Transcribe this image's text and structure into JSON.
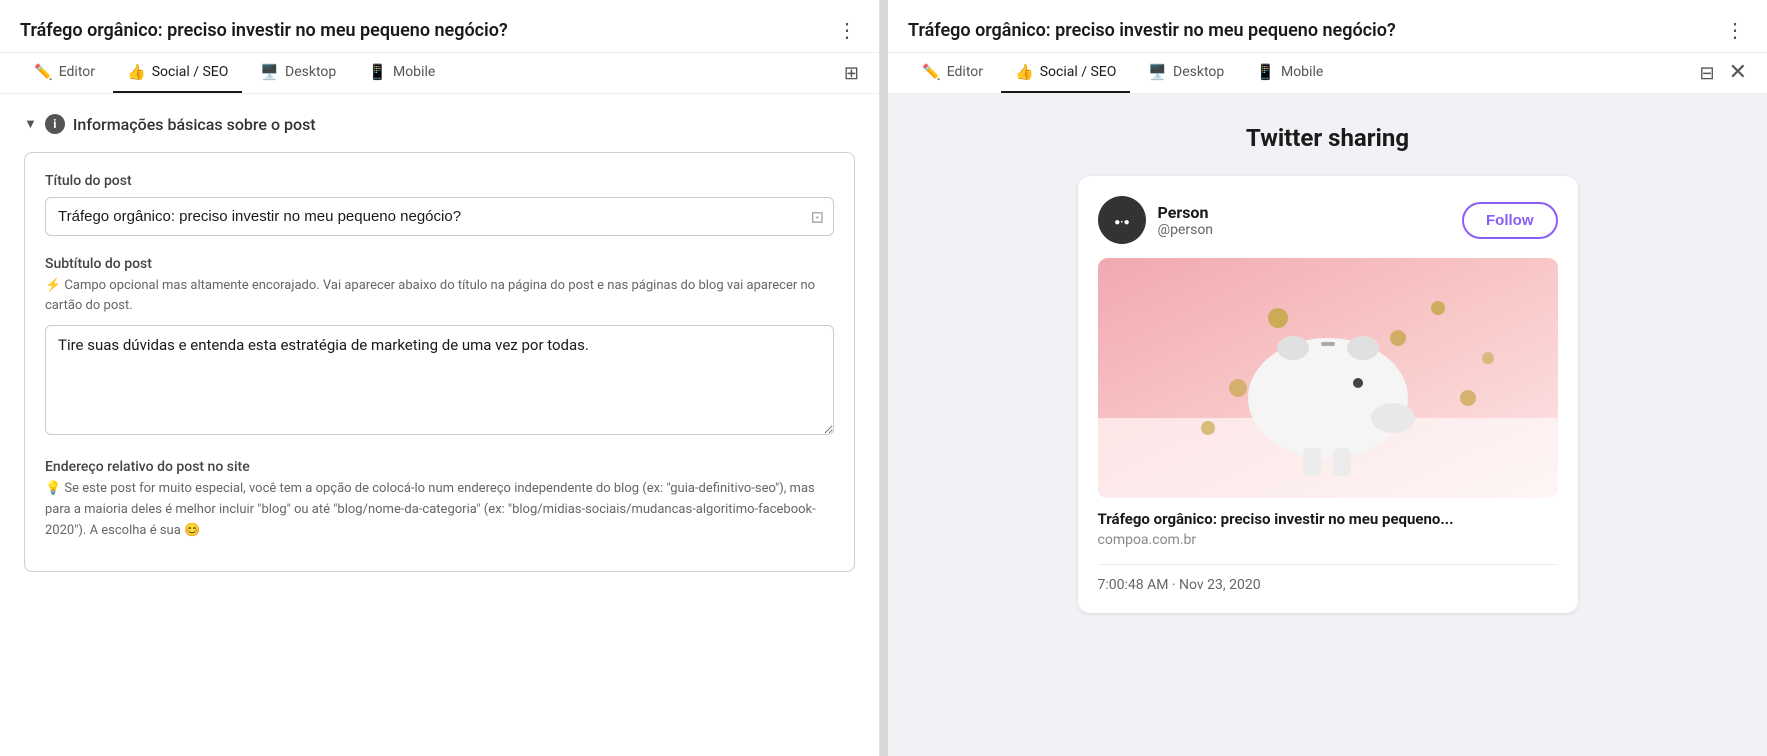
{
  "left": {
    "title": "Tráfego orgânico: preciso investir no meu pequeno negócio?",
    "more_icon": "⋮",
    "tabs": [
      {
        "id": "editor",
        "label": "Editor",
        "icon": "✏️",
        "active": false
      },
      {
        "id": "social-seo",
        "label": "Social / SEO",
        "icon": "👍",
        "active": true
      },
      {
        "id": "desktop",
        "label": "Desktop",
        "icon": "🖥️",
        "active": false
      },
      {
        "id": "mobile",
        "label": "Mobile",
        "icon": "📱",
        "active": false
      }
    ],
    "split_icon": "⊞",
    "section": {
      "toggle": "▼",
      "info_icon": "i",
      "title": "Informações básicas sobre o post"
    },
    "form": {
      "titulo_label": "Título do post",
      "titulo_value": "Tráfego orgânico: preciso investir no meu pequeno negócio?",
      "titulo_icon": "⊡",
      "subtitulo_label": "Subtítulo do post",
      "subtitulo_hint": "⚡ Campo opcional mas altamente encorajado. Vai aparecer abaixo do título na página do post e nas páginas do blog vai aparecer no cartão do post.",
      "subtitulo_value": "Tire suas dúvidas e entenda esta estratégia de marketing de uma vez por todas.",
      "url_label": "Endereço relativo do post no site",
      "url_hint": "💡 Se este post for muito especial, você tem a opção de colocá-lo num endereço independente do blog (ex: \"guia-definitivo-seo\"), mas para a maioria deles é melhor incluir \"blog\" ou até \"blog/nome-da-categoria\" (ex: \"blog/midias-sociais/mudancas-algoritimo-facebook-2020\"). A escolha é sua 😊"
    }
  },
  "right": {
    "title": "Tráfego orgânico: preciso investir no meu pequeno negócio?",
    "more_icon": "⋮",
    "tabs": [
      {
        "id": "editor",
        "label": "Editor",
        "icon": "✏️",
        "active": false
      },
      {
        "id": "social-seo",
        "label": "Social / SEO",
        "icon": "👍",
        "active": true
      },
      {
        "id": "desktop",
        "label": "Desktop",
        "icon": "🖥️",
        "active": false
      },
      {
        "id": "mobile",
        "label": "Mobile",
        "icon": "📱",
        "active": false
      }
    ],
    "split_icon": "⊟",
    "close_icon": "✕",
    "section_heading": "Twitter sharing",
    "twitter_card": {
      "person_name": "Person",
      "person_handle": "@person",
      "follow_label": "Follow",
      "tweet_title": "Tráfego orgânico: preciso investir no meu pequeno...",
      "tweet_url": "compoa.com.br",
      "timestamp": "7:00:48 AM · Nov 23, 2020"
    }
  }
}
